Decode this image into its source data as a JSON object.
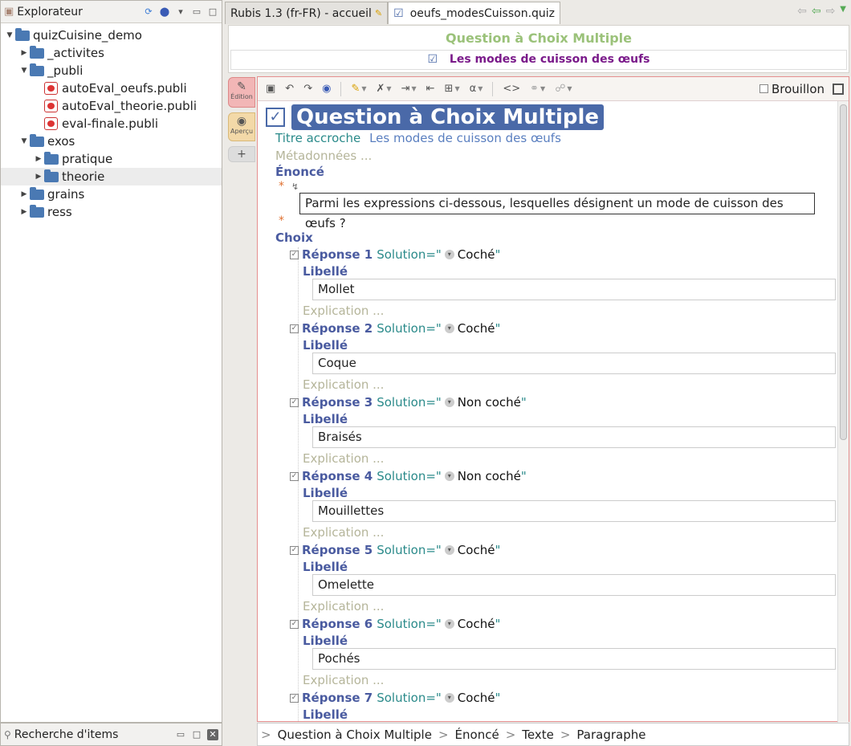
{
  "explorer": {
    "title": "Explorateur",
    "tree": [
      {
        "label": "quizCuisine_demo",
        "depth": 0,
        "type": "folder",
        "expanded": true
      },
      {
        "label": "_activites",
        "depth": 1,
        "type": "folder",
        "expanded": false
      },
      {
        "label": "_publi",
        "depth": 1,
        "type": "folder",
        "expanded": true
      },
      {
        "label": "autoEval_oeufs.publi",
        "depth": 2,
        "type": "publi"
      },
      {
        "label": "autoEval_theorie.publi",
        "depth": 2,
        "type": "publi"
      },
      {
        "label": "eval-finale.publi",
        "depth": 2,
        "type": "publi"
      },
      {
        "label": "exos",
        "depth": 1,
        "type": "folder",
        "expanded": true
      },
      {
        "label": "pratique",
        "depth": 2,
        "type": "folder",
        "expanded": false
      },
      {
        "label": "theorie",
        "depth": 2,
        "type": "folder",
        "expanded": false,
        "selected": true
      },
      {
        "label": "grains",
        "depth": 1,
        "type": "folder",
        "expanded": false
      },
      {
        "label": "ress",
        "depth": 1,
        "type": "folder",
        "expanded": false
      }
    ]
  },
  "search_panel": {
    "title": "Recherche d'items"
  },
  "tabs": [
    {
      "label": "Rubis 1.3 (fr-FR) - accueil",
      "active": false
    },
    {
      "label": "oeufs_modesCuisson.quiz",
      "active": true
    }
  ],
  "header": {
    "type_label": "Question à Choix Multiple",
    "title": "Les modes de cuisson des œufs"
  },
  "modes": {
    "edition": "Édition",
    "apercu": "Aperçu",
    "add": "+"
  },
  "toolbar": {
    "brouillon_label": "Brouillon",
    "alpha": "α",
    "code": "<>"
  },
  "doc": {
    "heading": "Question à Choix Multiple",
    "titre_accroche_label": "Titre accroche",
    "titre_accroche_value": "Les modes de cuisson des œufs",
    "metadonnees": "Métadonnées ...",
    "enonce_label": "Énoncé",
    "enonce_text": "Parmi les expressions ci-dessous, lesquelles désignent un mode de cuisson des œufs ?",
    "choix_label": "Choix",
    "libelle_label": "Libellé",
    "explication_label": "Explication ...",
    "solution_label": "Solution=\"",
    "quote_close": "\"",
    "answers": [
      {
        "title": "Réponse 1",
        "solution": "Coché",
        "libelle": "Mollet"
      },
      {
        "title": "Réponse 2",
        "solution": "Coché",
        "libelle": "Coque"
      },
      {
        "title": "Réponse 3",
        "solution": "Non coché",
        "libelle": "Braisés"
      },
      {
        "title": "Réponse 4",
        "solution": "Non coché",
        "libelle": "Mouillettes"
      },
      {
        "title": "Réponse 5",
        "solution": "Coché",
        "libelle": "Omelette"
      },
      {
        "title": "Réponse 6",
        "solution": "Coché",
        "libelle": "Pochés"
      },
      {
        "title": "Réponse 7",
        "solution": "Coché",
        "libelle": ""
      }
    ]
  },
  "breadcrumb": [
    "Question à Choix Multiple",
    "Énoncé",
    "Texte",
    "Paragraphe"
  ]
}
